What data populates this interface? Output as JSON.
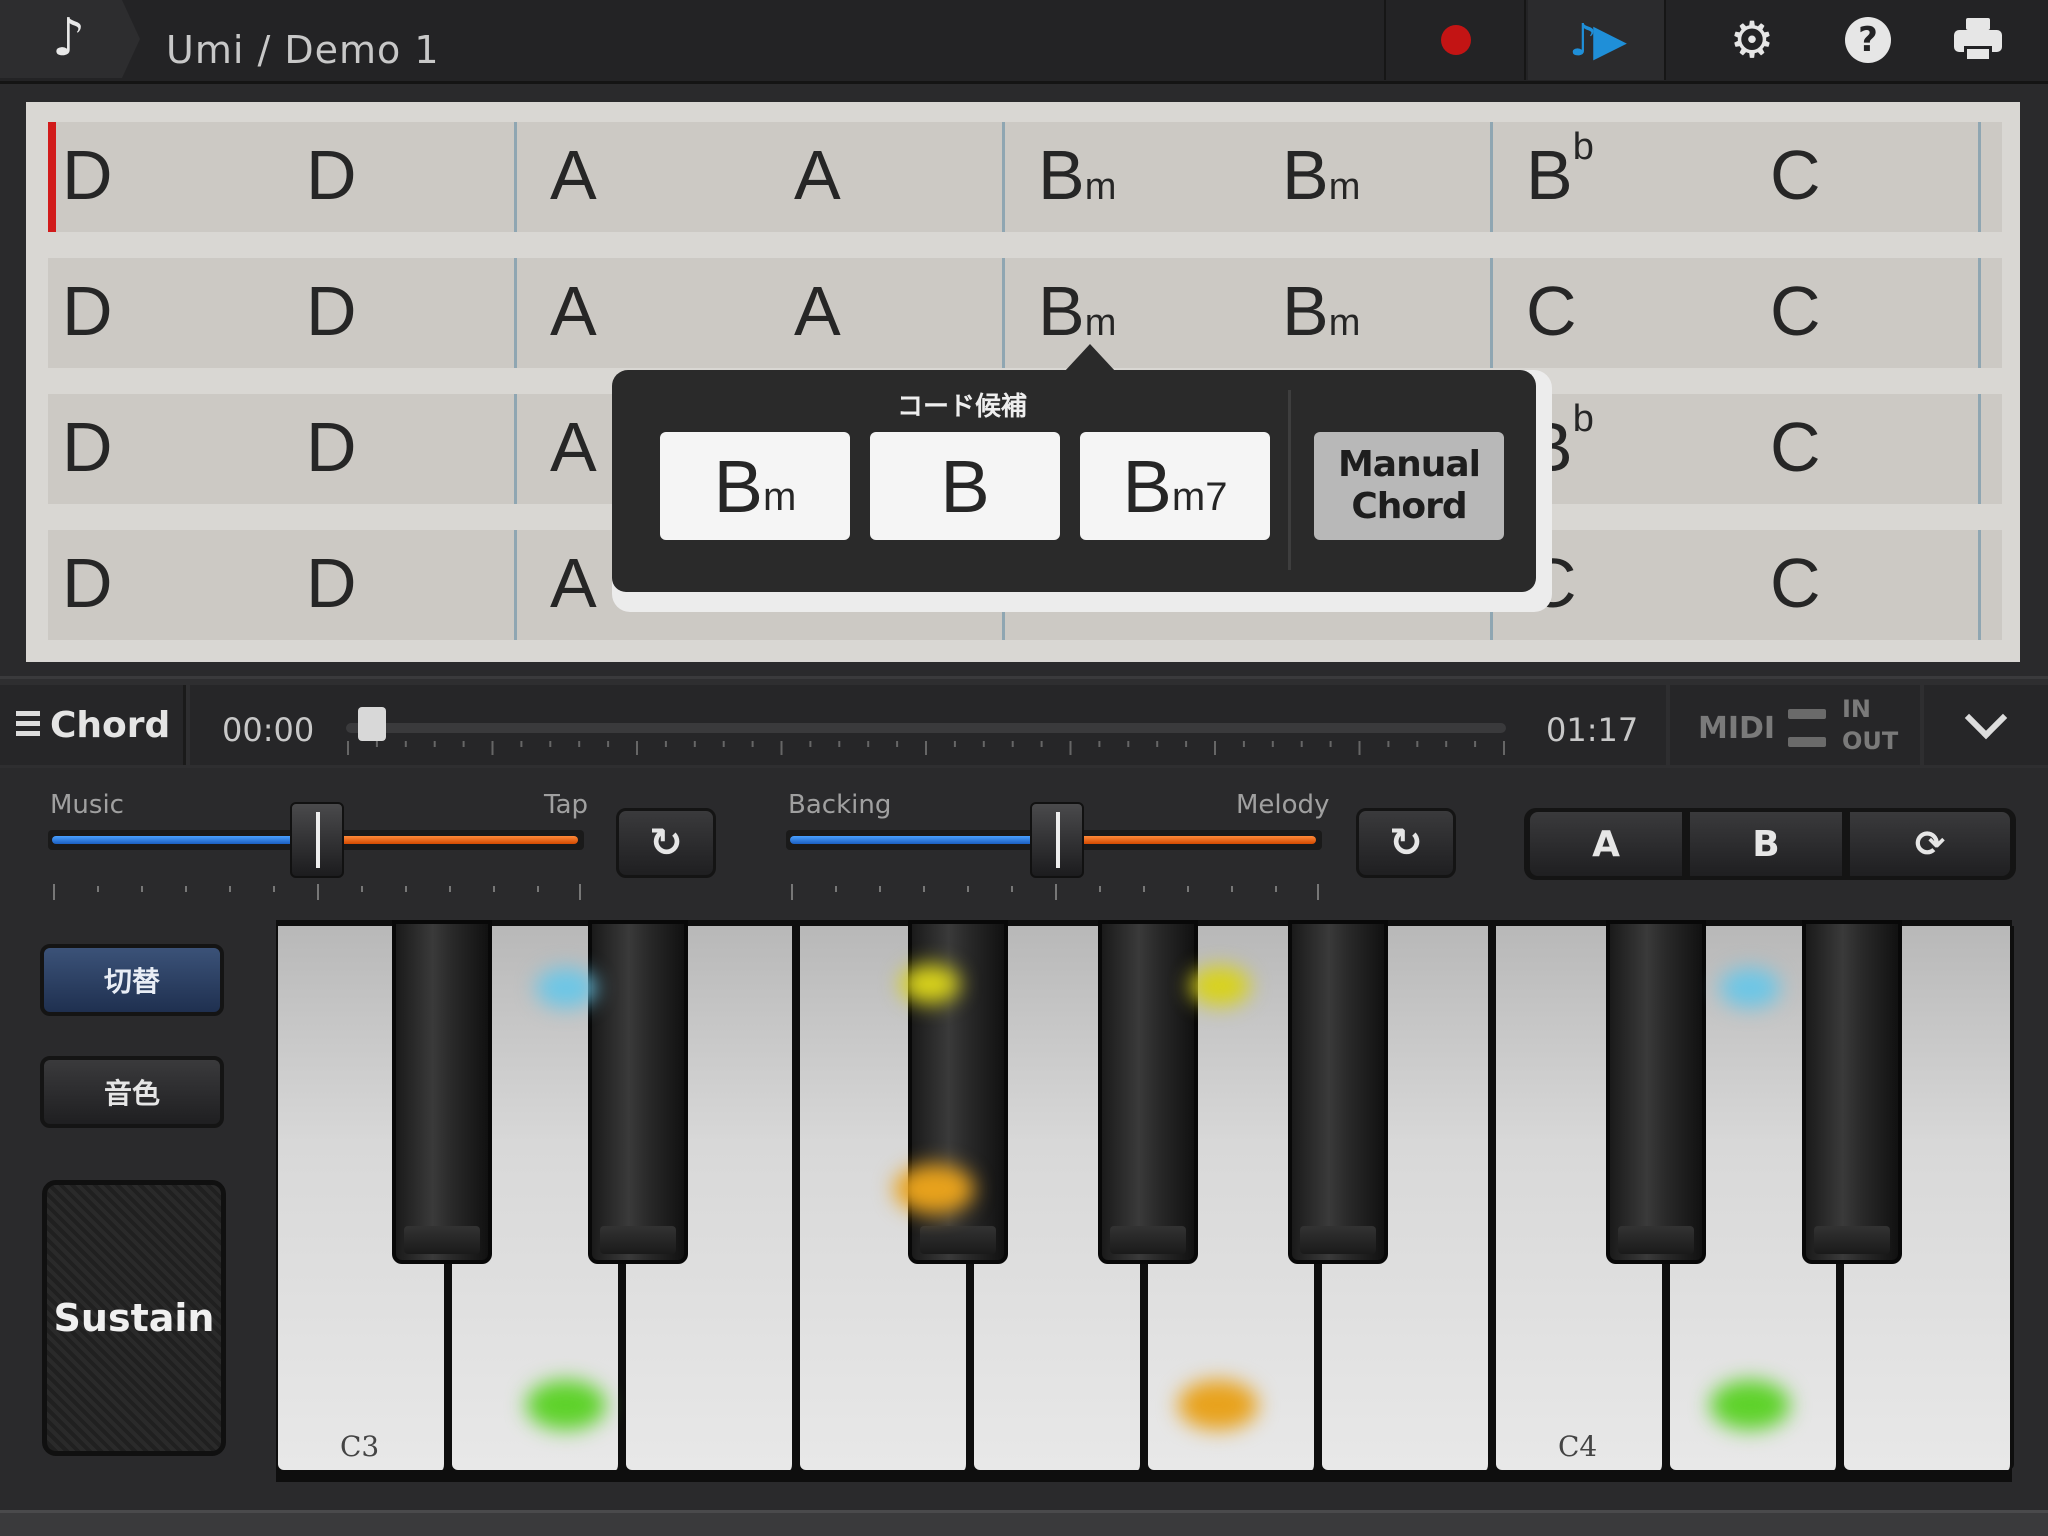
{
  "header": {
    "app_icon": "music-note-icon",
    "title": "Umi / Demo 1",
    "buttons": [
      "record-icon",
      "play-melody-icon",
      "gear-icon",
      "help-icon",
      "print-icon"
    ],
    "record_color": "#c31414",
    "play_color": "#1f8fd8"
  },
  "chord_grid": {
    "rows": [
      [
        {
          "r": "D",
          "q": ""
        },
        {
          "r": "D",
          "q": ""
        },
        {
          "r": "A",
          "q": ""
        },
        {
          "r": "A",
          "q": ""
        },
        {
          "r": "B",
          "q": "m"
        },
        {
          "r": "B",
          "q": "m"
        },
        {
          "r": "B",
          "q": "",
          "sup": "b"
        },
        {
          "r": "C",
          "q": ""
        }
      ],
      [
        {
          "r": "D",
          "q": ""
        },
        {
          "r": "D",
          "q": ""
        },
        {
          "r": "A",
          "q": ""
        },
        {
          "r": "A",
          "q": ""
        },
        {
          "r": "B",
          "q": "m"
        },
        {
          "r": "B",
          "q": "m"
        },
        {
          "r": "C",
          "q": ""
        },
        {
          "r": "C",
          "q": ""
        }
      ],
      [
        {
          "r": "D",
          "q": ""
        },
        {
          "r": "D",
          "q": ""
        },
        {
          "r": "A",
          "q": ""
        },
        {
          "r": "",
          "q": ""
        },
        {
          "r": "",
          "q": ""
        },
        {
          "r": "",
          "q": ""
        },
        {
          "r": "B",
          "q": "",
          "sup": "b"
        },
        {
          "r": "C",
          "q": ""
        }
      ],
      [
        {
          "r": "D",
          "q": ""
        },
        {
          "r": "D",
          "q": ""
        },
        {
          "r": "A",
          "q": ""
        },
        {
          "r": "",
          "q": ""
        },
        {
          "r": "",
          "q": ""
        },
        {
          "r": "",
          "q": ""
        },
        {
          "r": "C",
          "q": ""
        },
        {
          "r": "C",
          "q": ""
        }
      ]
    ]
  },
  "popup": {
    "title": "コード候補",
    "candidates": [
      {
        "root": "B",
        "quality": "m"
      },
      {
        "root": "B",
        "quality": ""
      },
      {
        "root": "B",
        "quality": "m7"
      }
    ],
    "manual_line1": "Manual",
    "manual_line2": "Chord"
  },
  "transport": {
    "menu_label": "Chord",
    "time_start": "00:00",
    "time_end": "01:17",
    "progress": 0.01,
    "midi_label": "MIDI",
    "midi_in": "IN",
    "midi_out": "OUT"
  },
  "controls": {
    "slider1": {
      "left_label": "Music",
      "right_label": "Tap",
      "value": 0.5
    },
    "slider2": {
      "left_label": "Backing",
      "right_label": "Melody",
      "value": 0.5
    },
    "reset_icon": "undo-arrow-icon",
    "ab_a": "A",
    "ab_b": "B",
    "loop_icon": "refresh-icon"
  },
  "left_panel": {
    "switch_label": "切替",
    "tone_label": "音色",
    "sustain_label": "Sustain"
  },
  "keyboard": {
    "label_c3": "C3",
    "label_c4": "C4",
    "highlight_colors": {
      "green": "#5ed22a",
      "orange": "#e8a21c",
      "yellow": "#d8d21c",
      "cyan": "#6cc6e6"
    }
  }
}
